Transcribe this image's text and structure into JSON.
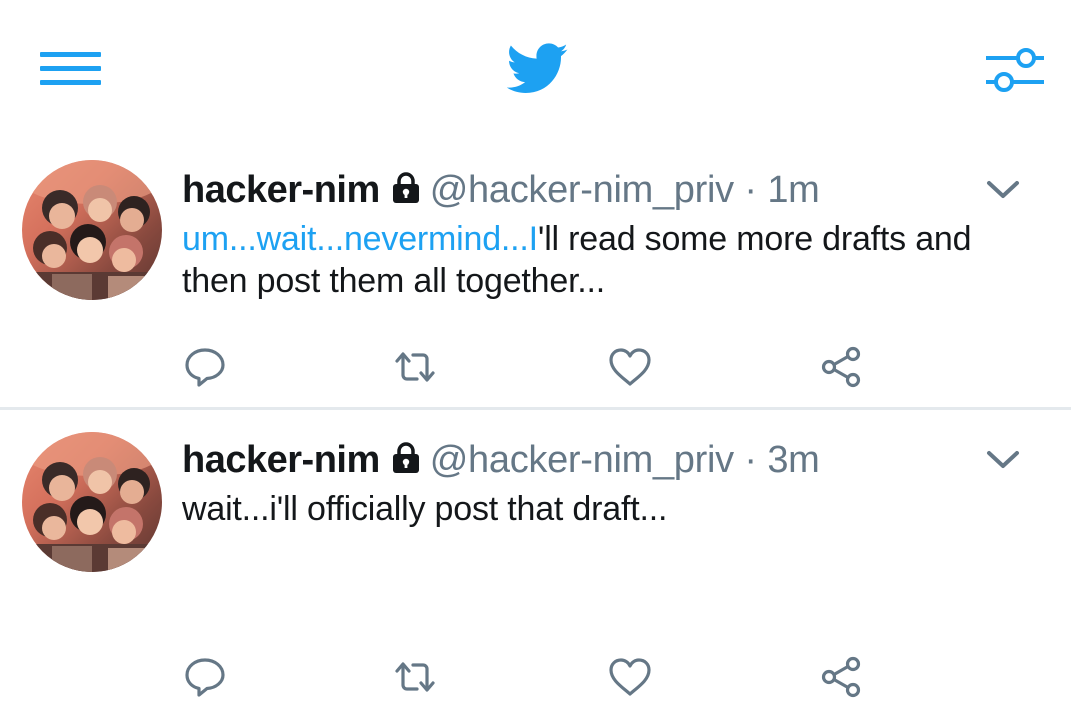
{
  "header": {
    "menu_icon": "hamburger-menu-icon",
    "logo_icon": "twitter-bird-icon",
    "filter_icon": "sliders-filter-icon",
    "accent_color": "#1da1f2"
  },
  "tweets": [
    {
      "name": "hacker-nim",
      "protected_icon": "lock-icon",
      "handle": "@hacker-nim_priv",
      "separator": "·",
      "time": "1m",
      "text_link": "um...wait...nevermind...I",
      "text_rest": "'ll read some more drafts and then post them all together...",
      "actions": [
        "reply-icon",
        "retweet-icon",
        "like-icon",
        "share-icon"
      ]
    },
    {
      "name": "hacker-nim",
      "protected_icon": "lock-icon",
      "handle": "@hacker-nim_priv",
      "separator": "·",
      "time": "3m",
      "text_link": "",
      "text_rest": "wait...i'll officially post that draft...",
      "actions": [
        "reply-icon",
        "retweet-icon",
        "like-icon",
        "share-icon"
      ]
    }
  ],
  "colors": {
    "text_primary": "#14171a",
    "text_secondary": "#657786",
    "link": "#1da1f2",
    "divider": "#e4e9ed"
  }
}
